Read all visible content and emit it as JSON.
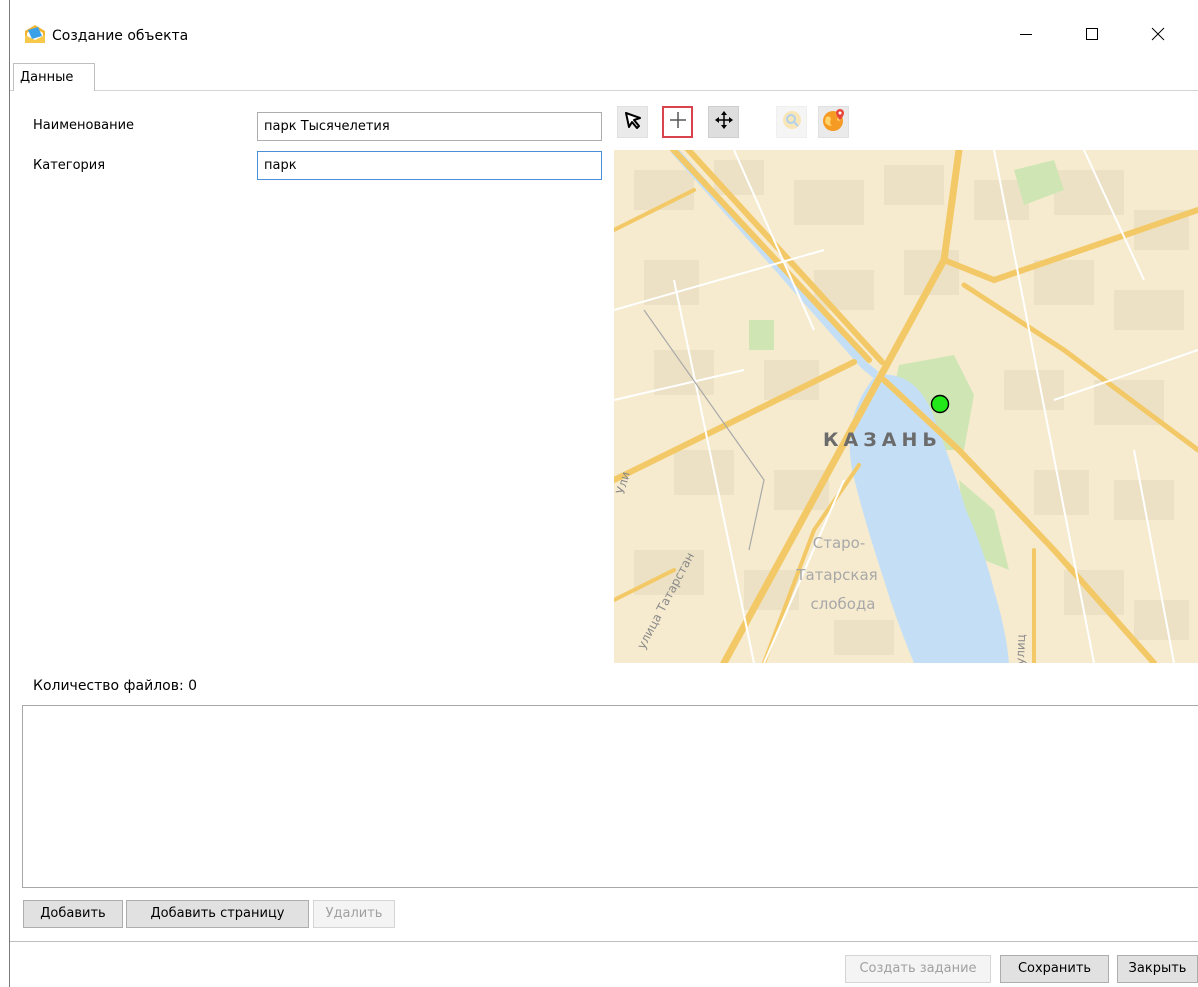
{
  "window": {
    "title": "Создание объекта",
    "app_icon": "envelope-folder-icon",
    "minimize_icon": "minimize-icon",
    "maximize_icon": "maximize-icon",
    "close_icon": "close-icon"
  },
  "tabs": [
    {
      "label": "Данные",
      "active": true
    }
  ],
  "form": {
    "name_label": "Наименование",
    "name_value": "парк Тысячелетия",
    "category_label": "Категория",
    "category_value": "парк"
  },
  "map_toolbar": {
    "tools": [
      {
        "icon": "select-arrow-icon",
        "selected": false
      },
      {
        "icon": "add-point-crosshair-icon",
        "selected": true
      },
      {
        "icon": "move-pan-icon",
        "selected": false
      },
      {
        "icon": "zoom-search-icon",
        "selected": false,
        "disabled": true
      },
      {
        "icon": "globe-location-icon",
        "selected": false
      }
    ]
  },
  "map": {
    "city_label": "КАЗАНЬ",
    "district_label_lines": [
      "Старо-",
      "Татарская",
      "слобода"
    ],
    "street_label_1": "улица Татарстан",
    "street_label_2": "Ули",
    "street_label_3": "улиц",
    "marker_color": "#22e81a",
    "water_color": "#c8e0f4",
    "road_color": "#f5cf6e",
    "park_color": "#cfe6b4"
  },
  "files": {
    "count_label": "Количество файлов: 0"
  },
  "buttons": {
    "add": "Добавить",
    "add_page": "Добавить страницу",
    "delete": "Удалить",
    "create_task": "Создать задание",
    "save": "Сохранить",
    "close": "Закрыть"
  }
}
